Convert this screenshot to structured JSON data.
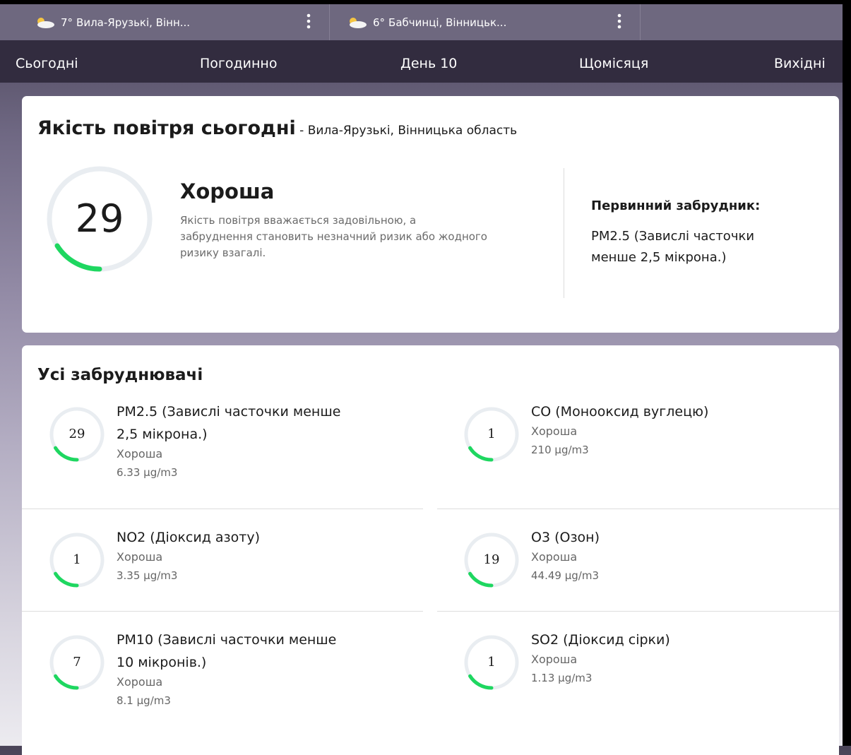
{
  "locations": [
    {
      "temp": "7°",
      "name": "Вила-Ярузькі, Вінн..."
    },
    {
      "temp": "6°",
      "name": "Бабчинці, Вінницьк..."
    }
  ],
  "nav": {
    "tabs": [
      {
        "label": "Сьогодні"
      },
      {
        "label": "Погодинно"
      },
      {
        "label": "День 10"
      },
      {
        "label": "Щомісяця"
      },
      {
        "label": "Вихідні"
      }
    ]
  },
  "aqi_card": {
    "title": "Якість повітря сьогодні",
    "separator": " - ",
    "location": "Вила-Ярузькі, Вінницька область",
    "value": "29",
    "gauge_fraction": 0.16,
    "quality": "Хороша",
    "description": "Якість повітря вважається задовільною, а забруднення становить незначний ризик або жодного ризику взагалі.",
    "primary_label": "Первинний забрудник:",
    "primary_value": "PM2.5 (Завислі часточки менше 2,5 мікрона.)"
  },
  "pollutants_card": {
    "title": "Усі забруднювачі",
    "items": [
      {
        "value": "29",
        "name": "PM2.5 (Завислі часточки менше 2,5 мікрона.)",
        "quality": "Хороша",
        "concentration": "6.33 µg/m3",
        "fraction": 0.16
      },
      {
        "value": "1",
        "name": "CO (Монооксид вуглецю)",
        "quality": "Хороша",
        "concentration": "210 µg/m3",
        "fraction": 0.16
      },
      {
        "value": "1",
        "name": "NO2 (Діоксид азоту)",
        "quality": "Хороша",
        "concentration": "3.35 µg/m3",
        "fraction": 0.16
      },
      {
        "value": "19",
        "name": "O3 (Озон)",
        "quality": "Хороша",
        "concentration": "44.49 µg/m3",
        "fraction": 0.16
      },
      {
        "value": "7",
        "name": "PM10 (Завислі часточки менше 10 мікронів.)",
        "quality": "Хороша",
        "concentration": "8.1 µg/m3",
        "fraction": 0.16
      },
      {
        "value": "1",
        "name": "SO2 (Діоксид сірки)",
        "quality": "Хороша",
        "concentration": "1.13 µg/m3",
        "fraction": 0.16
      }
    ]
  },
  "colors": {
    "good": "#1ed760",
    "track": "#e9edf1",
    "nav_bg": "#322c3f",
    "location_bar": "#6e687f"
  },
  "icons": {
    "weather": "partly-cloudy-icon",
    "menu": "kebab-menu-icon"
  }
}
